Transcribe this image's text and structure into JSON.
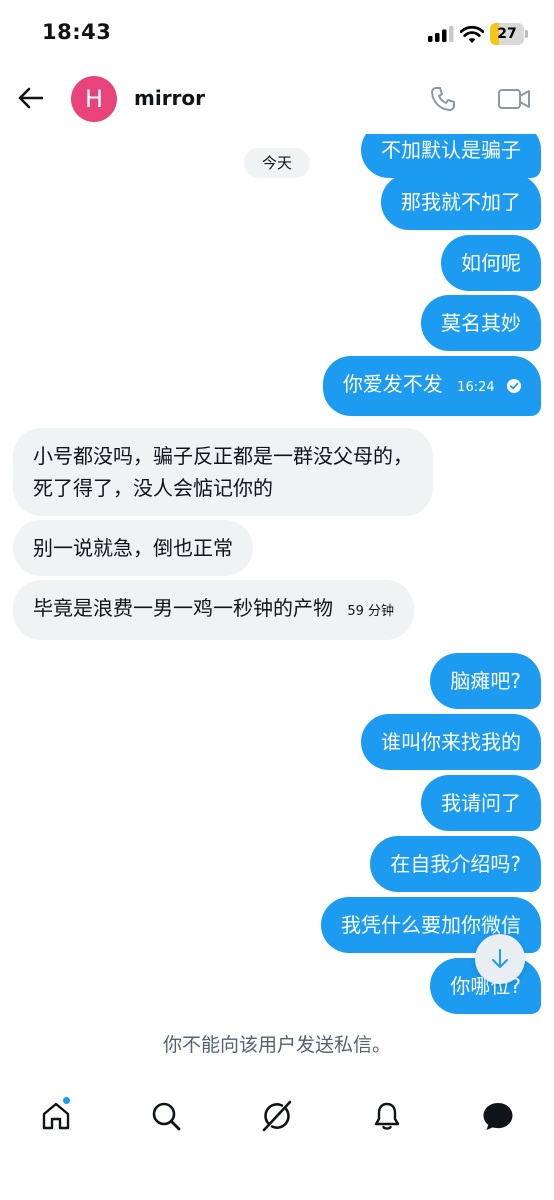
{
  "status_bar": {
    "time": "18:43",
    "battery_text": "27",
    "battery_level": 0.27,
    "battery_color": "#f5c518"
  },
  "header": {
    "back_icon": "arrow-left-icon",
    "avatar_letter": "H",
    "avatar_color": "#e8437a",
    "contact_name": "mirror",
    "call_icon": "phone-icon",
    "video_icon": "video-camera-icon"
  },
  "date_chip": "今天",
  "messages": [
    {
      "dir": "out",
      "text": "不加默认是骗子"
    },
    {
      "dir": "out",
      "text": "那我就不加了"
    },
    {
      "dir": "out",
      "text": "如何呢"
    },
    {
      "dir": "out",
      "text": "莫名其妙"
    },
    {
      "dir": "out",
      "text": "你爱发不发",
      "time": "16:24",
      "read": true
    },
    {
      "dir": "in",
      "text_line1": "小号都没吗，骗子反正都是一群没父母的，",
      "text_line2": "死了得了，没人会惦记你的"
    },
    {
      "dir": "in",
      "text": "别一说就急，倒也正常"
    },
    {
      "dir": "in",
      "text": "毕竟是浪费一男一鸡一秒钟的产物",
      "time": "59 分钟"
    },
    {
      "dir": "out",
      "text": "脑瘫吧?"
    },
    {
      "dir": "out",
      "text": "谁叫你来找我的"
    },
    {
      "dir": "out",
      "text": "我请问了"
    },
    {
      "dir": "out",
      "text": "在自我介绍吗?"
    },
    {
      "dir": "out",
      "text": "我凭什么要加你微信"
    },
    {
      "dir": "out",
      "text": "你哪位?"
    }
  ],
  "notice": "你不能向该用户发送私信。",
  "nav": {
    "home_icon": "home-icon",
    "search_icon": "search-icon",
    "grok_icon": "grok-icon",
    "notifications_icon": "bell-icon",
    "messages_icon": "messages-icon"
  },
  "colors": {
    "accent": "#1d9bf0",
    "incoming_bubble": "#eff3f4",
    "muted_text": "#536471"
  }
}
